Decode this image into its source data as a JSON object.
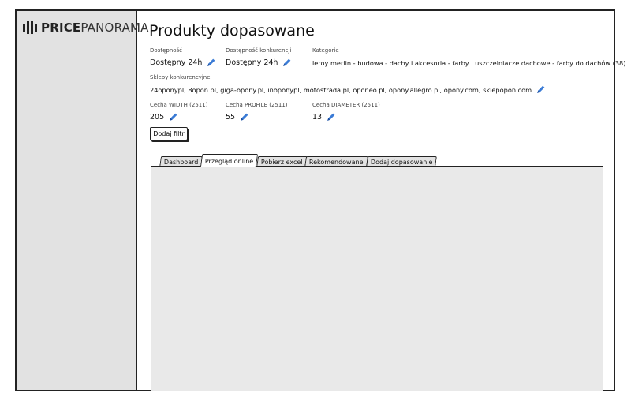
{
  "app": {
    "logo_bold": "PRICE",
    "logo_light": "PANORAMA"
  },
  "main": {
    "title": "Produkty dopasowane",
    "filters": [
      {
        "label": "Dostępność",
        "value": "Dostępny 24h"
      },
      {
        "label": "Dostępność konkurencji",
        "value": "Dostępny 24h"
      },
      {
        "label": "Kategorie",
        "value": "leroy merlin - budowa - dachy i akcesoria - farby i uszczelniacze dachowe - farby do dachów (38)"
      },
      {
        "label": "Sklepy konkurencyjne",
        "value": "24oponypl, 8opon.pl, giga-opony.pl, inoponypl, motostrada.pl, oponeo.pl, opony.allegro.pl, opony.com, sklepopon.com"
      },
      {
        "label": "Cecha WIDTH (2511)",
        "value": "205"
      },
      {
        "label": "Cecha PROFILE (2511)",
        "value": "55"
      },
      {
        "label": "Cecha DIAMETER (2511)",
        "value": "13"
      }
    ],
    "add_filter_label": "Dodaj filtr",
    "tabs": [
      {
        "label": "Dashboard"
      },
      {
        "label": "Przegląd online"
      },
      {
        "label": "Pobierz excel"
      },
      {
        "label": "Rekomendowane"
      },
      {
        "label": "Dodaj dopasowanie"
      }
    ],
    "active_tab": "Przegląd online"
  },
  "colors": {
    "sidebar_bg": "#e2e2e2",
    "pencil": "#3b7bd6",
    "panel_bg": "#e9e9e9"
  },
  "icons": {
    "edit": "pencil-icon",
    "logo": "bars-logo-icon"
  }
}
